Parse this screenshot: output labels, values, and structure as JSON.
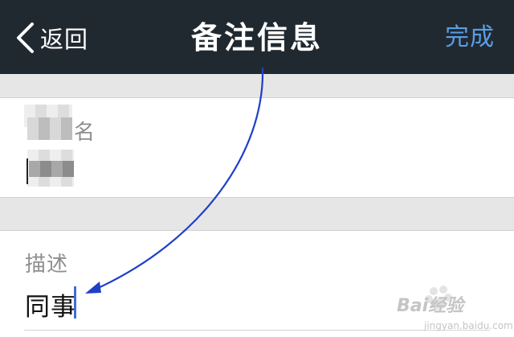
{
  "navbar": {
    "back_label": "返回",
    "title": "备注信息",
    "done_label": "完成",
    "done_color": "#5a9ee6",
    "background": "#212930"
  },
  "fields": {
    "name": {
      "label_visible": "名",
      "value_redacted": true
    },
    "description": {
      "label": "描述",
      "value": "同事"
    }
  },
  "annotation": {
    "arrow_color": "#1f3fc8"
  },
  "watermark": {
    "brand": "Bai经验",
    "site": "jingyan.baidu.com"
  }
}
